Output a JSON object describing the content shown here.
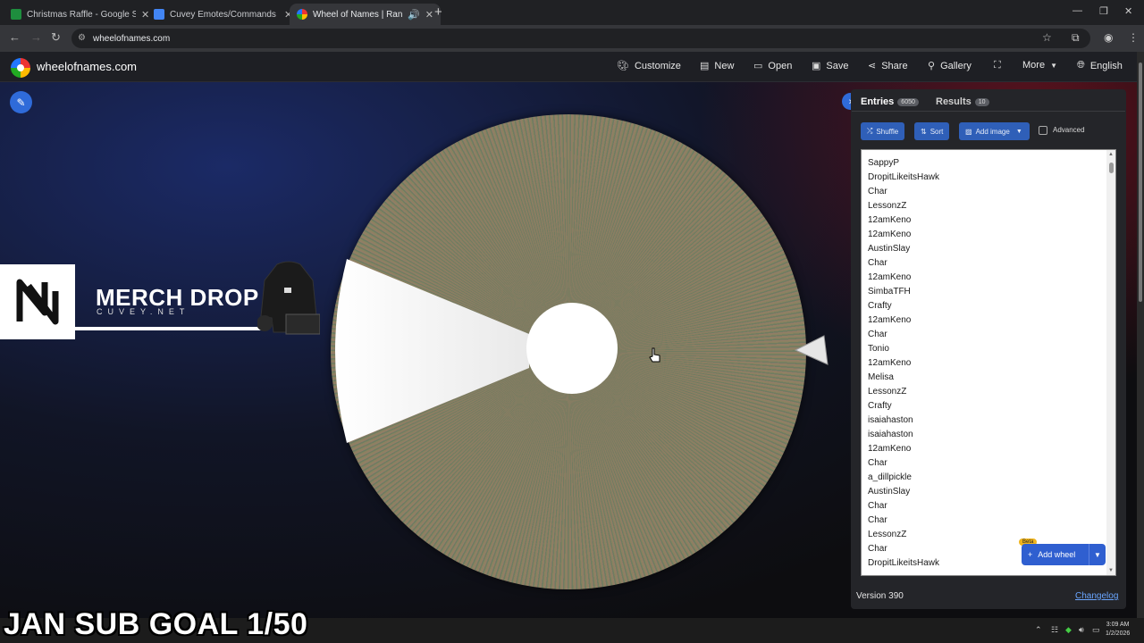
{
  "browser": {
    "tabs": [
      {
        "title": "Christmas Raffle - Google Sheets",
        "color": "#1e8e3e"
      },
      {
        "title": "Cuvey Emotes/Commands - Goo",
        "color": "#4285f4"
      },
      {
        "title": "Wheel of Names | Random",
        "color": "#e33b3b"
      }
    ],
    "url": "wheelofnames.com"
  },
  "header": {
    "site_title": "wheelofnames.com",
    "menu": {
      "customize": "Customize",
      "new": "New",
      "open": "Open",
      "save": "Save",
      "share": "Share",
      "gallery": "Gallery",
      "more": "More",
      "language": "English"
    }
  },
  "merch": {
    "title": "MERCH DROP",
    "subtitle": "CUVEY.NET"
  },
  "panel": {
    "tabs": {
      "entries_label": "Entries",
      "entries_count": "6050",
      "results_label": "Results",
      "results_count": "10"
    },
    "buttons": {
      "shuffle": "Shuffle",
      "sort": "Sort",
      "add_image": "Add image",
      "advanced": "Advanced"
    },
    "entries": [
      "SappyP",
      "DropitLikeitsHawk",
      "Char",
      "LessonzZ",
      "12amKeno",
      "12amKeno",
      "AustinSlay",
      "Char",
      "12amKeno",
      "SimbaTFH",
      "Crafty",
      "12amKeno",
      "Char",
      "Tonio",
      "12amKeno",
      "Melisa",
      "LessonzZ",
      "Crafty",
      "isaiahaston",
      "isaiahaston",
      "12amKeno",
      "Char",
      "a_dillpickle",
      "AustinSlay",
      "Char",
      "Char",
      "LessonzZ",
      "Char",
      "DropitLikeitsHawk"
    ],
    "add_wheel": "Add wheel",
    "beta": "Beta",
    "version": "Version 390",
    "changelog": "Changelog"
  },
  "overlay": {
    "goal_text": "JAN SUB GOAL 1/50"
  },
  "taskbar": {
    "time": "3:09 AM",
    "date": "1/2/2026"
  },
  "colors": {
    "accent": "#2f6bd9",
    "panel_bg": "#242529"
  }
}
